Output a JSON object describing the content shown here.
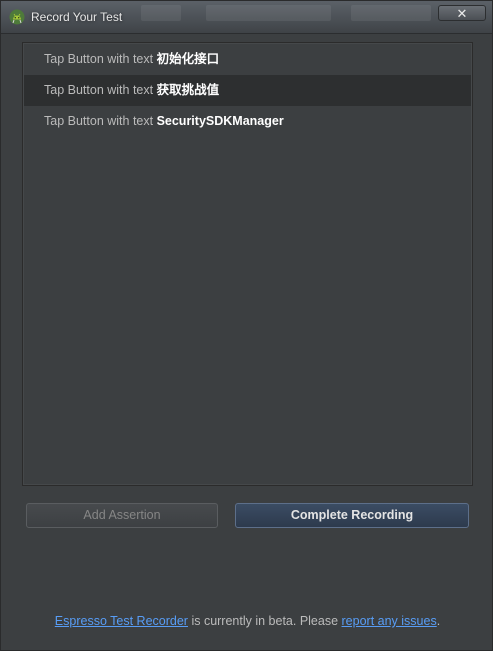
{
  "window": {
    "title": "Record Your Test",
    "close_label": "✕"
  },
  "steps": [
    {
      "prefix": "Tap Button with text ",
      "value": "初始化接口"
    },
    {
      "prefix": "Tap Button with text ",
      "value": "获取挑战值"
    },
    {
      "prefix": "Tap Button with text ",
      "value": "SecuritySDKManager"
    }
  ],
  "buttons": {
    "add_assertion": "Add Assertion",
    "complete_recording": "Complete Recording"
  },
  "footer": {
    "link1": "Espresso Test Recorder",
    "middle": " is currently in beta. Please ",
    "link2": "report any issues",
    "end": "."
  },
  "colors": {
    "background": "#3c3f41",
    "selected_row": "#2d2f30",
    "link": "#589df6",
    "primary_button": "#2d3a4d"
  },
  "icons": {
    "app": "android-studio-icon",
    "close": "close-icon"
  }
}
